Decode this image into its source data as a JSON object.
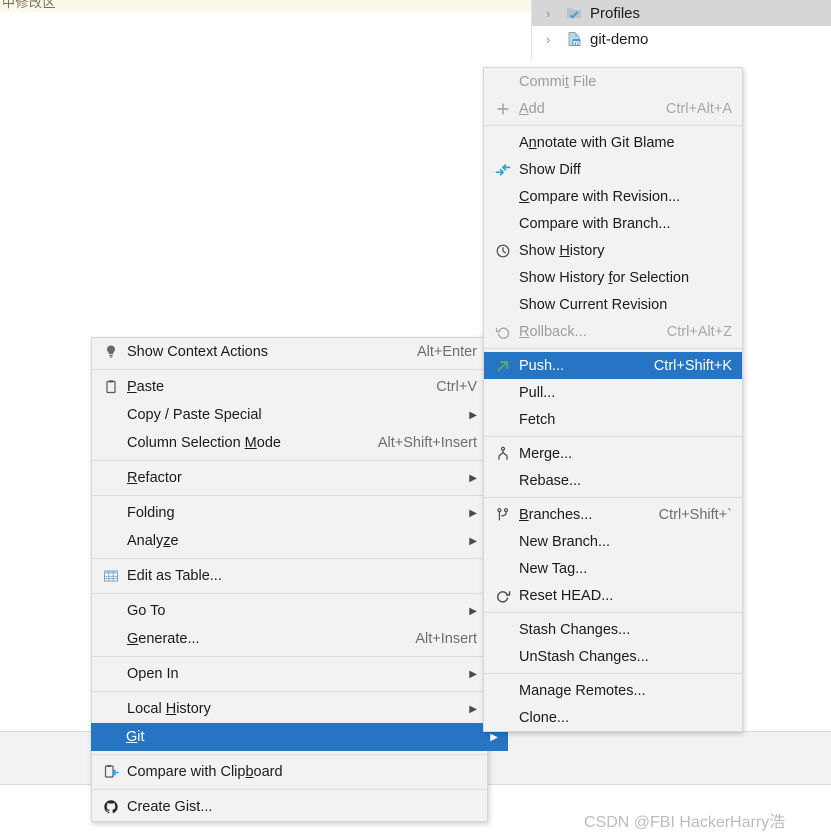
{
  "editor": {
    "cjk_fragment": "中修改区"
  },
  "project_tree": {
    "rows": [
      {
        "label": "Profiles",
        "icon": "profiles-folder-icon",
        "arrow": "›",
        "selected": true
      },
      {
        "label": "git-demo",
        "icon": "maven-module-icon",
        "arrow": "›",
        "selected": false
      }
    ]
  },
  "context_menu": {
    "items": [
      {
        "label": "Show Context Actions",
        "shortcut": "Alt+Enter",
        "icon": "lightbulb-icon",
        "arrow": "",
        "state": "normal",
        "sep_after": true
      },
      {
        "label": "Paste",
        "mnemonic": "P",
        "shortcut": "Ctrl+V",
        "icon": "clipboard-icon",
        "arrow": "",
        "state": "normal",
        "sep_after": false
      },
      {
        "label": "Copy / Paste Special",
        "shortcut": "",
        "icon": "",
        "arrow": "▶",
        "state": "normal",
        "sep_after": false
      },
      {
        "label": "Column Selection Mode",
        "mnemonic": "M",
        "shortcut": "Alt+Shift+Insert",
        "icon": "",
        "arrow": "",
        "state": "normal",
        "sep_after": true
      },
      {
        "label": "Refactor",
        "mnemonic": "R",
        "shortcut": "",
        "icon": "",
        "arrow": "▶",
        "state": "normal",
        "sep_after": true
      },
      {
        "label": "Folding",
        "shortcut": "",
        "icon": "",
        "arrow": "▶",
        "state": "normal",
        "sep_after": false
      },
      {
        "label": "Analyze",
        "mnemonic": "z",
        "shortcut": "",
        "icon": "",
        "arrow": "▶",
        "state": "normal",
        "sep_after": true
      },
      {
        "label": "Edit as Table...",
        "shortcut": "",
        "icon": "table-icon",
        "arrow": "",
        "state": "normal",
        "sep_after": true
      },
      {
        "label": "Go To",
        "shortcut": "",
        "icon": "",
        "arrow": "▶",
        "state": "normal",
        "sep_after": false
      },
      {
        "label": "Generate...",
        "mnemonic": "G",
        "shortcut": "Alt+Insert",
        "icon": "",
        "arrow": "",
        "state": "normal",
        "sep_after": true
      },
      {
        "label": "Open In",
        "shortcut": "",
        "icon": "",
        "arrow": "▶",
        "state": "normal",
        "sep_after": true
      },
      {
        "label": "Local History",
        "mnemonic": "H",
        "shortcut": "",
        "icon": "",
        "arrow": "▶",
        "state": "normal",
        "sep_after": false
      },
      {
        "label": "Git",
        "mnemonic": "G",
        "shortcut": "",
        "icon": "",
        "arrow": "▶",
        "state": "selected",
        "sep_after": true
      },
      {
        "label": "Compare with Clipboard",
        "mnemonic": "b",
        "shortcut": "",
        "icon": "compare-clipboard-icon",
        "arrow": "",
        "state": "normal",
        "sep_after": true
      },
      {
        "label": "Create Gist...",
        "shortcut": "",
        "icon": "github-icon",
        "arrow": "",
        "state": "normal",
        "sep_after": false
      }
    ]
  },
  "git_submenu": {
    "items": [
      {
        "label": "Commit File",
        "mnemonic": "t",
        "shortcut": "",
        "icon": "",
        "state": "disabled",
        "sep_after": false
      },
      {
        "label": "Add",
        "mnemonic": "A",
        "shortcut": "Ctrl+Alt+A",
        "icon": "plus-icon",
        "state": "disabled",
        "sep_after": true
      },
      {
        "label": "Annotate with Git Blame",
        "mnemonic": "n",
        "shortcut": "",
        "icon": "",
        "state": "normal",
        "sep_after": false
      },
      {
        "label": "Show Diff",
        "shortcut": "",
        "icon": "diff-arrows-icon",
        "state": "normal",
        "sep_after": false
      },
      {
        "label": "Compare with Revision...",
        "mnemonic": "C",
        "shortcut": "",
        "icon": "",
        "state": "normal",
        "sep_after": false
      },
      {
        "label": "Compare with Branch...",
        "shortcut": "",
        "icon": "",
        "state": "normal",
        "sep_after": false
      },
      {
        "label": "Show History",
        "mnemonic": "H",
        "shortcut": "",
        "icon": "clock-icon",
        "state": "normal",
        "sep_after": false
      },
      {
        "label": "Show History for Selection",
        "mnemonic": "f",
        "shortcut": "",
        "icon": "",
        "state": "normal",
        "sep_after": false
      },
      {
        "label": "Show Current Revision",
        "shortcut": "",
        "icon": "",
        "state": "normal",
        "sep_after": false
      },
      {
        "label": "Rollback...",
        "mnemonic": "R",
        "shortcut": "Ctrl+Alt+Z",
        "icon": "rollback-icon",
        "state": "disabled",
        "sep_after": true
      },
      {
        "label": "Push...",
        "shortcut": "Ctrl+Shift+K",
        "icon": "push-arrow-icon",
        "state": "selected",
        "sep_after": false
      },
      {
        "label": "Pull...",
        "shortcut": "",
        "icon": "",
        "state": "normal",
        "sep_after": false
      },
      {
        "label": "Fetch",
        "shortcut": "",
        "icon": "",
        "state": "normal",
        "sep_after": true
      },
      {
        "label": "Merge...",
        "shortcut": "",
        "icon": "merge-icon",
        "state": "normal",
        "sep_after": false
      },
      {
        "label": "Rebase...",
        "shortcut": "",
        "icon": "",
        "state": "normal",
        "sep_after": true
      },
      {
        "label": "Branches...",
        "mnemonic": "B",
        "shortcut": "Ctrl+Shift+`",
        "icon": "branch-icon",
        "state": "normal",
        "sep_after": false
      },
      {
        "label": "New Branch...",
        "shortcut": "",
        "icon": "",
        "state": "normal",
        "sep_after": false
      },
      {
        "label": "New Tag...",
        "shortcut": "",
        "icon": "",
        "state": "normal",
        "sep_after": false
      },
      {
        "label": "Reset HEAD...",
        "shortcut": "",
        "icon": "reset-icon",
        "state": "normal",
        "sep_after": true
      },
      {
        "label": "Stash Changes...",
        "shortcut": "",
        "icon": "",
        "state": "normal",
        "sep_after": false
      },
      {
        "label": "UnStash Changes...",
        "shortcut": "",
        "icon": "",
        "state": "normal",
        "sep_after": true
      },
      {
        "label": "Manage Remotes...",
        "shortcut": "",
        "icon": "",
        "state": "normal",
        "sep_after": false
      },
      {
        "label": "Clone...",
        "shortcut": "",
        "icon": "",
        "state": "normal",
        "sep_after": false
      }
    ]
  },
  "watermark": {
    "text": "CSDN @FBI HackerHarry浩"
  },
  "colors": {
    "selection_blue": "#2675c4",
    "menu_background": "#f2f2f2",
    "tree_selected_gray": "#d6d6d6",
    "editor_band": "#fdf8ec",
    "disabled_text": "#9d9d9d",
    "push_arrow_green": "#59a869",
    "icon_blue": "#389fd6"
  }
}
